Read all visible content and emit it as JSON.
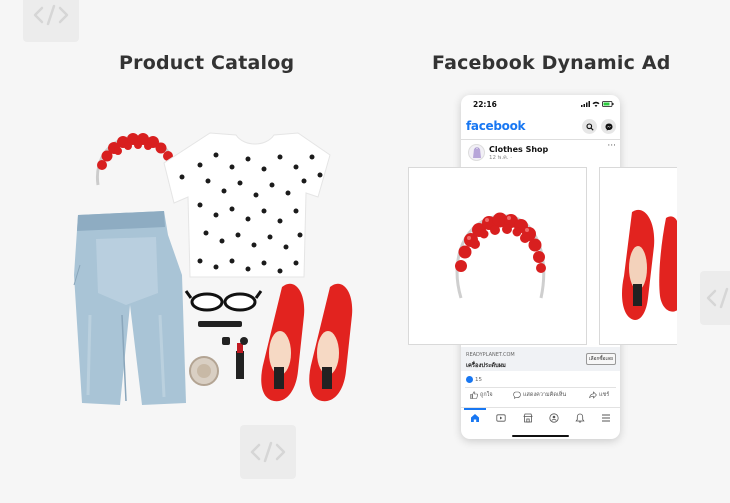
{
  "headings": {
    "left": "Product Catalog",
    "right": "Facebook Dynamic Ad"
  },
  "badges": {
    "icon": "code-icon"
  },
  "phone": {
    "status_time": "22:16",
    "app_logo": "facebook",
    "page_name": "Clothes Shop",
    "post_time": "12 พ.ค. ·",
    "more_label": "···",
    "link_domain": "READYPLANET.COM",
    "link_title": "เครื่องประดับผม",
    "cta_label": "เลือกซื้อเลย",
    "reaction_count": "15",
    "actions": {
      "like": "ถูกใจ",
      "comment": "แสดงความคิดเห็น",
      "share": "แชร์"
    },
    "nav_icons": [
      "home-icon",
      "video-icon",
      "marketplace-icon",
      "groups-icon",
      "bell-icon",
      "menu-icon"
    ]
  },
  "colors": {
    "facebook_blue": "#1877f2",
    "product_red": "#e02020",
    "background": "#f6f6f6"
  }
}
